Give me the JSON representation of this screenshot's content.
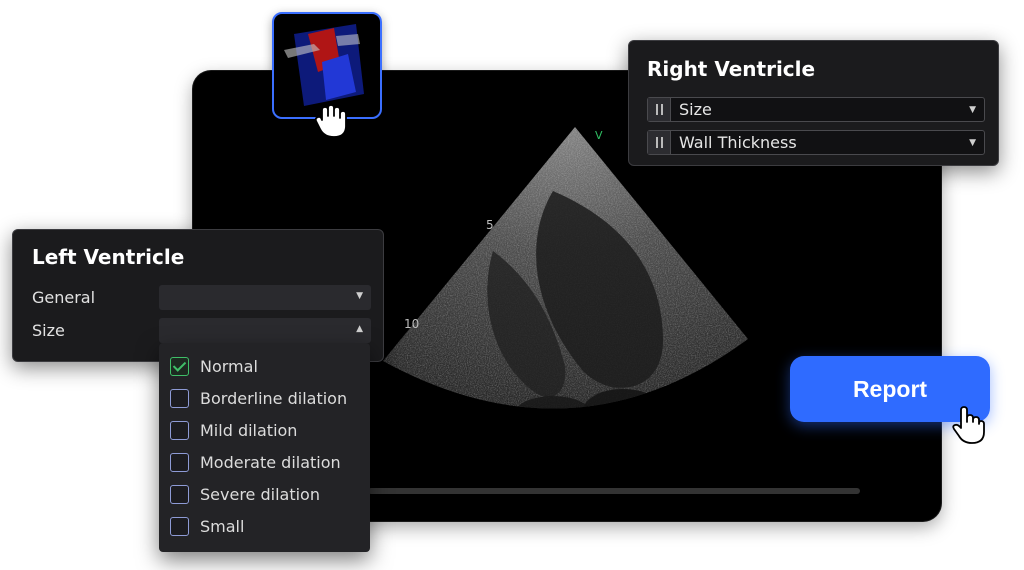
{
  "viewer": {
    "depth_labels": [
      "5",
      "10"
    ],
    "view_marker": "V"
  },
  "thumbnail": {
    "icon": "hand-pointer-icon",
    "accent_color": "#3b6fff"
  },
  "right_ventricle": {
    "title": "Right Ventricle",
    "rows": [
      {
        "label": "Size"
      },
      {
        "label": "Wall Thickness"
      }
    ]
  },
  "left_ventricle": {
    "title": "Left Ventricle",
    "fields": [
      {
        "label": "General",
        "value": ""
      },
      {
        "label": "Size",
        "value": ""
      }
    ],
    "size_options": [
      {
        "label": "Normal",
        "checked": true
      },
      {
        "label": "Borderline dilation",
        "checked": false
      },
      {
        "label": "Mild dilation",
        "checked": false
      },
      {
        "label": "Moderate dilation",
        "checked": false
      },
      {
        "label": "Severe dilation",
        "checked": false
      },
      {
        "label": "Small",
        "checked": false
      }
    ]
  },
  "report_button": {
    "label": "Report",
    "color": "#2f6bff"
  }
}
